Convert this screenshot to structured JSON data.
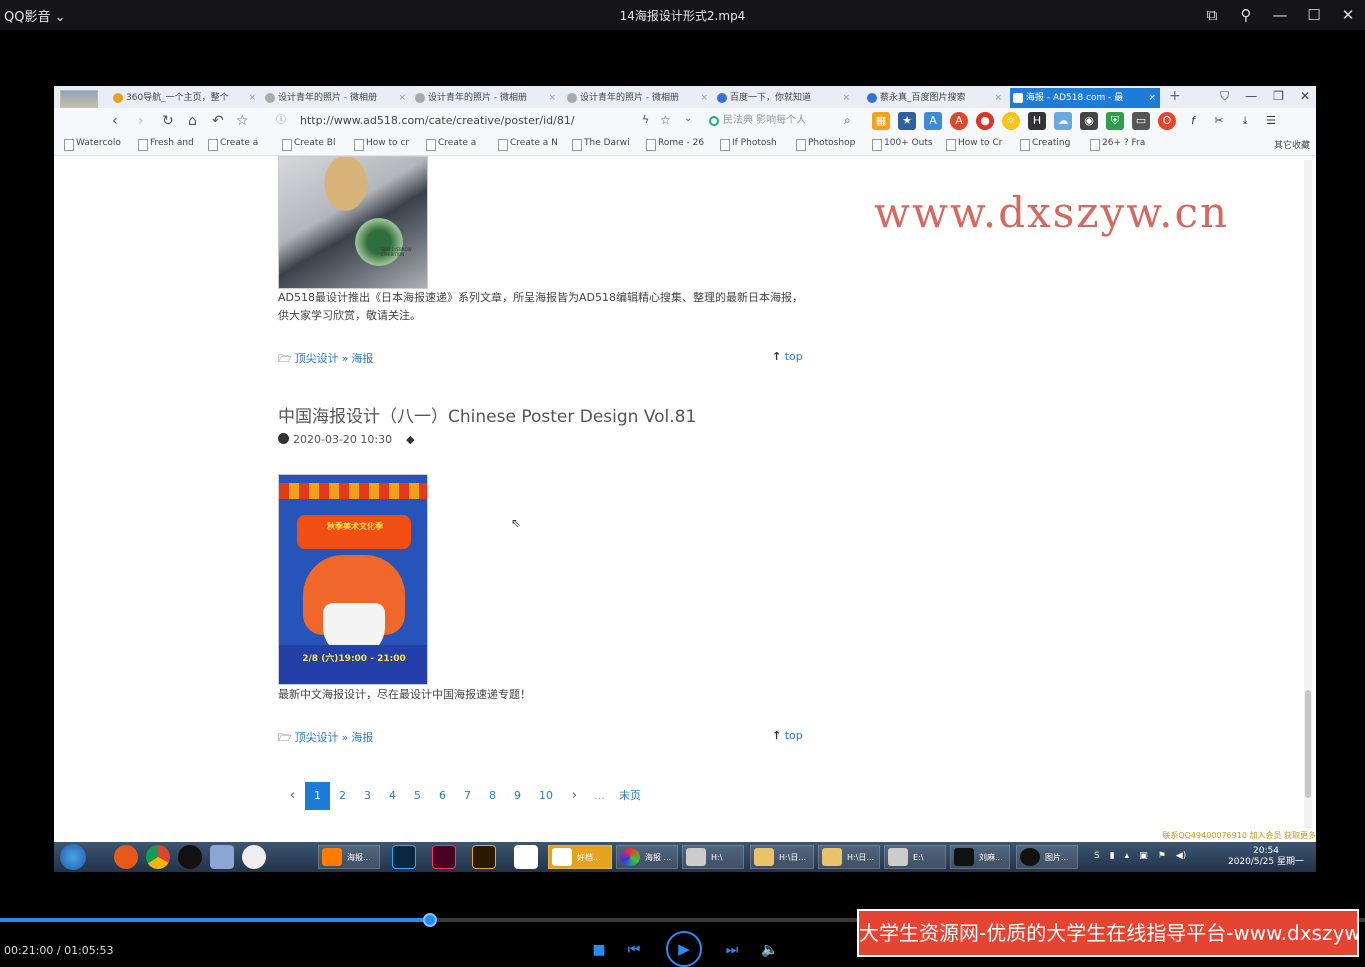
{
  "player": {
    "app_name": "QQ影音",
    "app_menu_arrow": "⌄",
    "file_name": "14海报设计形式2.mp4",
    "time_display": "00:21:00 / 01:05:53",
    "progress_fraction": 0.319
  },
  "browser": {
    "tabs": [
      {
        "label": "360导航_一个主页，整个"
      },
      {
        "label": "设计青年的照片 - 微相册"
      },
      {
        "label": "设计青年的照片 - 微相册"
      },
      {
        "label": "设计青年的照片 - 微相册"
      },
      {
        "label": "百度一下，你就知道"
      },
      {
        "label": "蔡永真_百度图片搜索"
      },
      {
        "label": "海报 - AD518.com - 最"
      }
    ],
    "new_tab": "+",
    "url": "http://www.ad518.com/cate/creative/poster/id/81/",
    "search_placeholder": "民法典 影响每个人",
    "bookmarks": [
      "Watercolo",
      "Fresh and",
      "Create a",
      "Create Bl",
      "How to cr",
      "Create a",
      "Create a N",
      "The Darwi",
      "Rome - 26",
      "If Photosh",
      "Photoshop",
      "100+ Outs",
      "How to Cr",
      "Creating",
      "26+ ? Fra"
    ],
    "bookmarks_other": "其它收藏"
  },
  "page": {
    "post1": {
      "description": "AD518最设计推出《日本海报速递》系列文章，所呈海报皆为AD518编辑精心搜集、整理的最新日本海报，供大家学习欣赏，敬请关注。",
      "poster_text": "SUKI EYEBROW EXHIBITION",
      "category_parent": "顶尖设计",
      "category_sep": "»",
      "category_child": "海报",
      "top_link": "top"
    },
    "post2": {
      "title": "中国海报设计（八一）Chinese Poster Design Vol.81",
      "date": "2020-03-20 10:30",
      "poster_headline": "秋季美术文化季",
      "poster_datetime": "2/8 (六)19:00 - 21:00",
      "description": "最新中文海报设计，尽在最设计中国海报速递专题！",
      "category_parent": "顶尖设计",
      "category_sep": "»",
      "category_child": "海报",
      "top_link": "top"
    },
    "pagination": {
      "prev": "‹",
      "pages": [
        "1",
        "2",
        "3",
        "4",
        "5",
        "6",
        "7",
        "8",
        "9",
        "10"
      ],
      "current": "1",
      "next": "›",
      "ellipsis": "...",
      "last": "末页"
    }
  },
  "watermarks": {
    "url": "www.dxszyw.cn",
    "small": "联系QQ49400076910 加入会员 获取更多",
    "banner": "大学生资源网-优质的大学生在线指导平台-www.dxszyw.cn"
  },
  "taskbar": {
    "buttons": [
      "海报...",
      "好档...",
      "海报 ...",
      "H:\\",
      "H:\\日...",
      "H:\\日...",
      "E:\\",
      "刘麻...",
      "图片..."
    ],
    "clock_time": "20:54",
    "clock_date": "2020/5/25 星期一"
  }
}
